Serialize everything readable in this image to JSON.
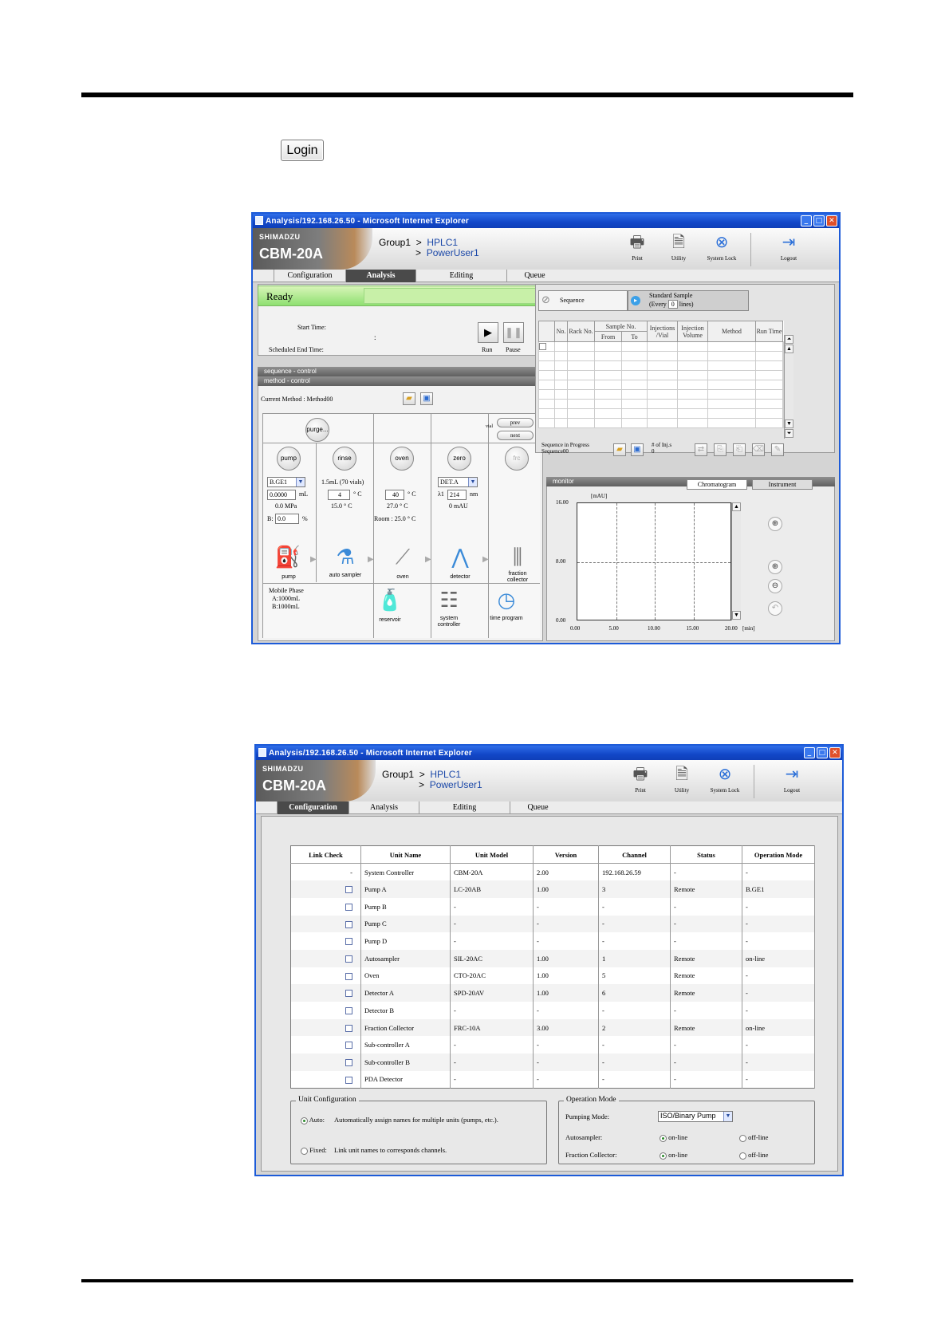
{
  "login_button": "Login",
  "window1": {
    "title": "Analysis/192.168.26.50 - Microsoft Internet Explorer",
    "brand": {
      "maker": "SHIMADZU",
      "model": "CBM-20A"
    },
    "path": {
      "group": "Group1",
      "sep": ">",
      "instrument": "HPLC1",
      "user": "PowerUser1"
    },
    "tools": {
      "print": "Print",
      "utility": "Utility",
      "system_lock": "System Lock",
      "logout": "Logout"
    },
    "tabs": [
      "Configuration",
      "Analysis",
      "Editing",
      "Queue"
    ],
    "status": "Ready",
    "start_time_label": "Start Time:",
    "sched_end_label": "Scheduled End Time:",
    "time_sep": ":",
    "run_label": "Run",
    "pause_label": "Pause",
    "sequence_control": "sequence - control",
    "method_control": "method - control",
    "current_method": "Current Method : Method00",
    "purge": "purge...",
    "prev": "prev",
    "next": "next",
    "vial": "vial",
    "pump": "pump",
    "rinse": "rinse",
    "oven": "oven",
    "zero": "zero",
    "frc": "frc",
    "pump_sel": "B.GE1",
    "flow_val": "0.0000",
    "flow_unit": "mL",
    "pressure": "0.0 MPa",
    "b_label": "B:",
    "b_val": "0.0",
    "b_unit": "%",
    "rinse_text": "1.5mL (70 vials)",
    "rinse_temp_val": "4",
    "deg_c": "° C",
    "rinse_temp2": "15.0 ° C",
    "oven_val": "40",
    "oven_temp2": "27.0 ° C",
    "room": "Room : 25.0 ° C",
    "det_sel": "DET.A",
    "lambda_label": "λ1",
    "lambda_val": "214",
    "nm": "nm",
    "mau": "0 mAU",
    "dev_pump": "pump",
    "dev_auto": "auto sampler",
    "dev_oven": "oven",
    "dev_detector": "detector",
    "dev_fraction": "fraction collector",
    "mobile_phase": "Mobile Phase",
    "mp_a": "A:1000mL",
    "mp_b": "B:1000mL",
    "dev_reservoir": "reservoir",
    "dev_sysctrl": "system controller",
    "dev_timeprog": "time program",
    "seq_tab": "Sequence",
    "std_tab": "Standard Sample",
    "std_every": "(Every",
    "std_every_val": "0",
    "std_lines": "lines)",
    "seq_headers": {
      "no": "No.",
      "rack": "Rack No.",
      "sample_no": "Sample No.",
      "from": "From",
      "to": "To",
      "inj_vial": "Injections /Vial",
      "inj_vol": "Injection Volume",
      "method": "Method",
      "run_time": "Run Time"
    },
    "seq_in_progress": "Sequence in Progress",
    "seq_name": "Sequence00",
    "num_inj_label": "# of Inj.s",
    "num_inj_val": "0",
    "monitor": "monitor",
    "chromatogram_tab": "Chromatogram",
    "instrument_tab": "Instrument",
    "chart_data": {
      "type": "line",
      "ylabel": "[mAU]",
      "xlabel": "[min]",
      "ylim": [
        0,
        16
      ],
      "xlim": [
        0,
        20
      ],
      "y_ticks": [
        "16.00",
        "8.00",
        "0.00"
      ],
      "x_ticks": [
        "0.00",
        "5.00",
        "10.00",
        "15.00",
        "20.00"
      ],
      "series": [],
      "grid": true
    }
  },
  "window2": {
    "title": "Analysis/192.168.26.50 - Microsoft Internet Explorer",
    "brand": {
      "maker": "SHIMADZU",
      "model": "CBM-20A"
    },
    "path": {
      "group": "Group1",
      "sep": ">",
      "instrument": "HPLC1",
      "user": "PowerUser1"
    },
    "tools": {
      "print": "Print",
      "utility": "Utility",
      "system_lock": "System Lock",
      "logout": "Logout"
    },
    "tabs": [
      "Configuration",
      "Analysis",
      "Editing",
      "Queue"
    ],
    "columns": [
      "Link Check",
      "Unit Name",
      "Unit Model",
      "Version",
      "Channel",
      "Status",
      "Operation Mode"
    ],
    "rows": [
      {
        "lc": "-",
        "check": false,
        "name": "System Controller",
        "model": "CBM-20A",
        "version": "2.00",
        "channel": "192.168.26.59",
        "status": "-",
        "mode": "-"
      },
      {
        "lc": "",
        "check": true,
        "name": "Pump A",
        "model": "LC-20AB",
        "version": "1.00",
        "channel": "3",
        "status": "Remote",
        "mode": "B.GE1"
      },
      {
        "lc": "",
        "check": true,
        "name": "Pump B",
        "model": "-",
        "version": "-",
        "channel": "-",
        "status": "-",
        "mode": "-"
      },
      {
        "lc": "",
        "check": true,
        "name": "Pump C",
        "model": "-",
        "version": "-",
        "channel": "-",
        "status": "-",
        "mode": "-"
      },
      {
        "lc": "",
        "check": true,
        "name": "Pump D",
        "model": "-",
        "version": "-",
        "channel": "-",
        "status": "-",
        "mode": "-"
      },
      {
        "lc": "",
        "check": true,
        "name": "Autosampler",
        "model": "SIL-20AC",
        "version": "1.00",
        "channel": "1",
        "status": "Remote",
        "mode": "on-line"
      },
      {
        "lc": "",
        "check": true,
        "name": "Oven",
        "model": "CTO-20AC",
        "version": "1.00",
        "channel": "5",
        "status": "Remote",
        "mode": "-"
      },
      {
        "lc": "",
        "check": true,
        "name": "Detector A",
        "model": "SPD-20AV",
        "version": "1.00",
        "channel": "6",
        "status": "Remote",
        "mode": "-"
      },
      {
        "lc": "",
        "check": true,
        "name": "Detector B",
        "model": "-",
        "version": "-",
        "channel": "-",
        "status": "-",
        "mode": "-"
      },
      {
        "lc": "",
        "check": true,
        "name": "Fraction Collector",
        "model": "FRC-10A",
        "version": "3.00",
        "channel": "2",
        "status": "Remote",
        "mode": "on-line"
      },
      {
        "lc": "",
        "check": true,
        "name": "Sub-controller A",
        "model": "-",
        "version": "-",
        "channel": "-",
        "status": "-",
        "mode": "-"
      },
      {
        "lc": "",
        "check": true,
        "name": "Sub-controller B",
        "model": "-",
        "version": "-",
        "channel": "-",
        "status": "-",
        "mode": "-"
      },
      {
        "lc": "",
        "check": true,
        "name": "PDA Detector",
        "model": "-",
        "version": "-",
        "channel": "-",
        "status": "-",
        "mode": "-"
      }
    ],
    "unit_config": {
      "legend": "Unit Configuration",
      "auto_label": "Auto:",
      "auto_desc": "Automatically assign names for multiple units (pumps, etc.).",
      "fixed_label": "Fixed:",
      "fixed_desc": "Link unit names to corresponds channels."
    },
    "op_mode": {
      "legend": "Operation Mode",
      "pumping_label": "Pumping Mode:",
      "pumping_val": "ISO/Binary Pump",
      "autosampler_label": "Autosampler:",
      "fraction_label": "Fraction Collector:",
      "online": "on-line",
      "offline": "off-line"
    }
  }
}
